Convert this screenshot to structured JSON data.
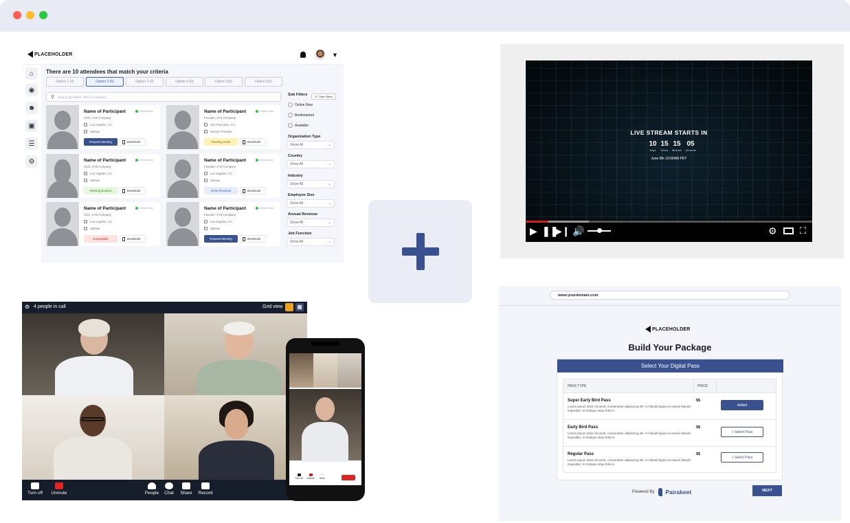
{
  "window": {
    "dots": [
      "#ff5f57",
      "#febc2e",
      "#28c840"
    ]
  },
  "colors": {
    "brand": "#3a5190",
    "accent_blue": "#3b5fcf",
    "online": "#28c840",
    "danger": "#e02424"
  },
  "dashboard": {
    "logo": "PLACEHOLDER",
    "icons": [
      "bell-icon",
      "avatar",
      "chevron-down-icon"
    ],
    "sidebar_icons": [
      "home-icon",
      "globe-icon",
      "people-icon",
      "chat-icon",
      "database-icon",
      "gear-icon"
    ],
    "title": "There are 10 attendees that match your criteria",
    "options": [
      "Option 1 (2)",
      "Option 2 (6)",
      "Option 3 (2)",
      "Option 4 (0)",
      "Option 5(6)",
      "Option 5(3)"
    ],
    "active_option": 1,
    "search_placeholder": "Search By Name, Title or Company",
    "cards": [
      {
        "name": "Name of Participant",
        "status": "Online Now",
        "title": "CEO, XYZ Company",
        "location": "Los Angeles, CA",
        "industry": "Startup",
        "action": "Request Meeting",
        "bookmark": "Bookmark"
      },
      {
        "name": "Name of Participant",
        "status": "Online Now",
        "title": "Founder, XYZ Company",
        "location": "San Francisco, CA",
        "industry": "Service Provider",
        "action": "Pending Invite",
        "bookmark": "Bookmark"
      },
      {
        "name": "Name of Participant",
        "status": "Online Now",
        "title": "CEO, XYZ Company",
        "location": "Los Angeles, CA",
        "industry": "Startup",
        "action": "Meeting Booked",
        "bookmark": "Bookmark"
      },
      {
        "name": "Name of Participant",
        "status": "Online Now",
        "title": "Founder, XYZ Company",
        "location": "Los Angeles, CA",
        "industry": "Startup",
        "action": "Invite Received",
        "bookmark": "Bookmark"
      },
      {
        "name": "Name of Participant",
        "status": "Online Now",
        "title": "CEO, XYZ Company",
        "location": "Los Angeles, CA",
        "industry": "Startup",
        "action": "Unavailable",
        "bookmark": "Bookmark"
      },
      {
        "name": "Name of Participant",
        "status": "Online Now",
        "title": "Founder, XYZ Company",
        "location": "Los Angeles, CA",
        "industry": "Startup",
        "action": "Request Meeting",
        "bookmark": "Bookmark"
      }
    ],
    "sub_filters": {
      "heading": "Sub Filters",
      "clear": "Clear Filters",
      "radios": [
        "Online Now",
        "Bookmarked",
        "Available"
      ],
      "selects": [
        {
          "label": "Organization Type",
          "value": "Show All"
        },
        {
          "label": "Country",
          "value": "Show All"
        },
        {
          "label": "Industry",
          "value": "Show All"
        },
        {
          "label": "Employee Size",
          "value": "Show All"
        },
        {
          "label": "Annual Revenue",
          "value": "Show All"
        },
        {
          "label": "Job Function",
          "value": "Show All"
        }
      ]
    }
  },
  "center": {
    "icon": "plus-icon"
  },
  "player": {
    "title": "LIVE STREAM STARTS IN",
    "countdown": [
      {
        "value": "10",
        "unit": "Days"
      },
      {
        "value": "15",
        "unit": "Hours"
      },
      {
        "value": "15",
        "unit": "Minutes"
      },
      {
        "value": "05",
        "unit": "Seconds"
      }
    ],
    "date": "June 8th 10:00AM PDT",
    "progress_played": 0.08,
    "progress_buffered": 0.22,
    "volume": 0.5,
    "controls": [
      "play-icon",
      "pause-icon",
      "next-icon",
      "volume-icon",
      "settings-icon",
      "theater-icon",
      "fullscreen-icon"
    ]
  },
  "call": {
    "people_count": "4 people in call",
    "view_label": "Grid view",
    "controls": [
      {
        "icon": "camera-icon",
        "label": "Turn off"
      },
      {
        "icon": "mic-off-icon",
        "label": "Unmute"
      },
      {
        "icon": "people-icon",
        "label": "People"
      },
      {
        "icon": "chat-icon",
        "label": "Chat"
      },
      {
        "icon": "share-icon",
        "label": "Share"
      },
      {
        "icon": "record-icon",
        "label": "Record"
      }
    ],
    "phone_controls": [
      "Turn off",
      "Unmute",
      "More"
    ]
  },
  "package": {
    "url": "www.yourdomain.com",
    "logo": "PLACEHOLDER",
    "title": "Build Your Package",
    "card_title": "Select Your Digital Pass",
    "col_type": "PASS TYPE",
    "col_price": "PRICE",
    "passes": [
      {
        "name": "Super Early Bird  Pass",
        "desc": "Lorem ipsum dolor sit amet, consectetur adipiscing elit. In blandit ligula et mauris blandit imperdiet. In tristique vitae felis in.",
        "price": "$$",
        "action": "Added"
      },
      {
        "name": "Early Bird Pass",
        "desc": "Lorem ipsum dolor sit amet, consectetur adipiscing elit. In blandit ligula et mauris blandit imperdiet. In tristique vitae felis in.",
        "price": "$$",
        "action": "+ Select Pass"
      },
      {
        "name": "Regular Pass",
        "desc": "Lorem ipsum dolor sit amet, consectetur adipiscing elit. In blandit ligula et mauris blandit imperdiet. In tristique vitae felis in.",
        "price": "$$",
        "action": "+ Select Pass"
      }
    ],
    "powered_by": "Powered By",
    "powered_brand": "Pairakeet",
    "next": "NEXT"
  }
}
